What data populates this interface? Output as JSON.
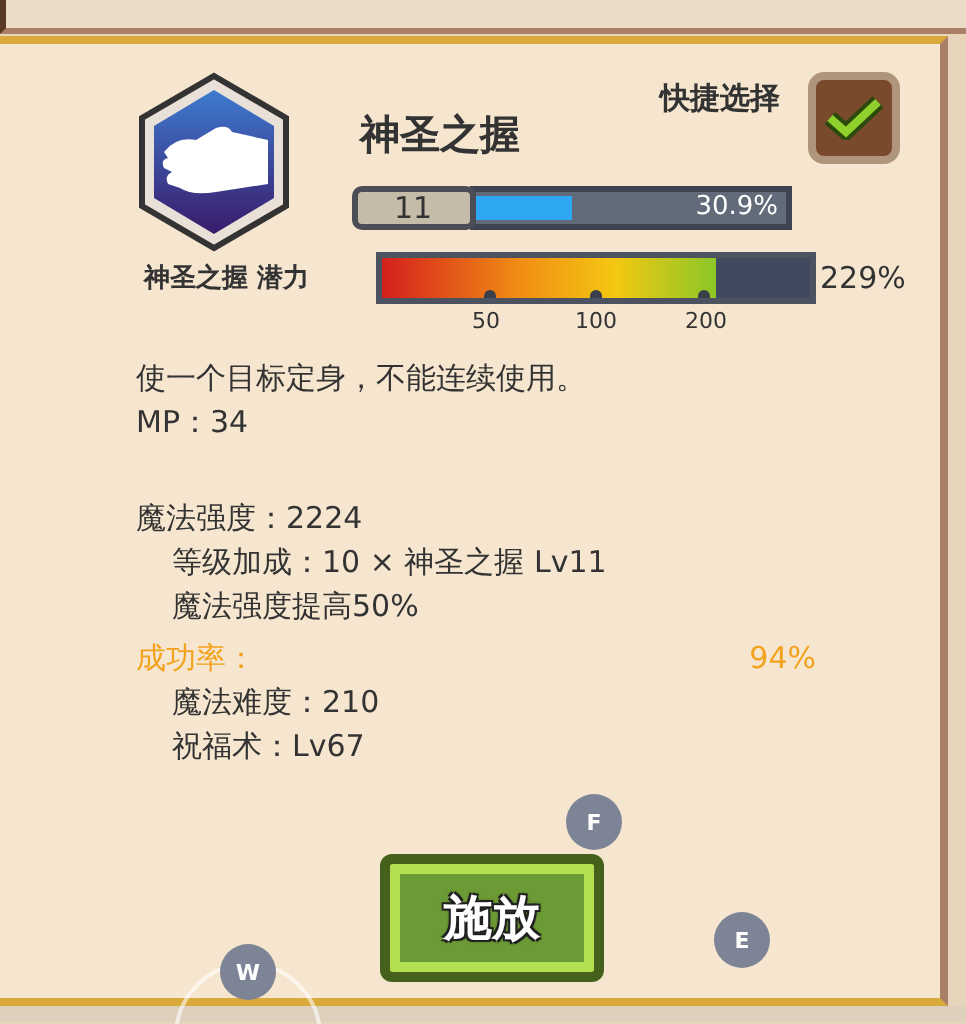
{
  "skill": {
    "name": "神圣之握",
    "level": "11",
    "progress": {
      "level": 0.309,
      "reading": "30.9%"
    }
  },
  "quick_select": {
    "label": "快捷选择",
    "checked": true
  },
  "potential": {
    "label": "神圣之握 潜力",
    "level": 0.78,
    "reading": "229%",
    "ticks": [
      "50",
      "100",
      "200"
    ]
  },
  "info": [
    {
      "kind": "text",
      "text": "使一个目标定身，不能连续使用。"
    },
    {
      "kind": "text",
      "text": "MP：34"
    },
    {
      "kind": "section",
      "text": "魔法强度：2224",
      "children": [
        {
          "kind": "text",
          "text": "等级加成：10 × 神圣之握 Lv11"
        },
        {
          "kind": "text",
          "text": "魔法强度提高50%"
        }
      ]
    },
    {
      "kind": "rate",
      "text": "成功率：",
      "value": "94%",
      "children": [
        {
          "kind": "text",
          "text": "魔法难度：210"
        },
        {
          "kind": "text",
          "text": "祝福术：Lv67"
        }
      ]
    }
  ],
  "cast_button": "施放",
  "key_hints": [
    {
      "key": "F",
      "kind": "top"
    },
    {
      "key": "E",
      "kind": "right"
    },
    {
      "key": "W",
      "kind": "wheel"
    }
  ]
}
